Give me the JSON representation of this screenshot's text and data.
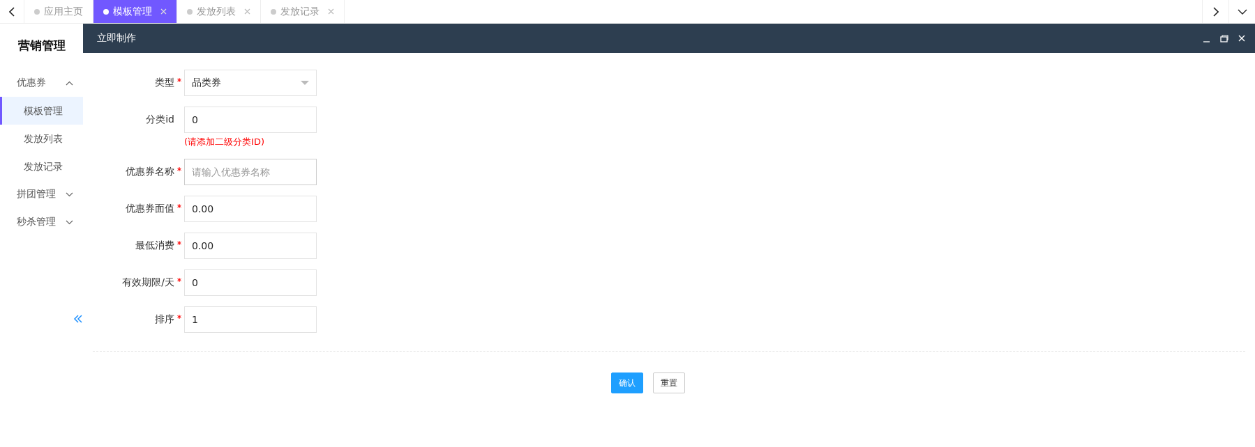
{
  "tabs": [
    {
      "label": "应用主页",
      "selected": false,
      "closable": false
    },
    {
      "label": "模板管理",
      "selected": true,
      "closable": true
    },
    {
      "label": "发放列表",
      "selected": false,
      "closable": true
    },
    {
      "label": "发放记录",
      "selected": false,
      "closable": true
    }
  ],
  "sidebar": {
    "title": "营销管理",
    "menus": [
      {
        "label": "优惠券",
        "expanded": true,
        "children": [
          {
            "label": "模板管理",
            "selected": true
          },
          {
            "label": "发放列表",
            "selected": false
          },
          {
            "label": "发放记录",
            "selected": false
          }
        ]
      },
      {
        "label": "拼团管理",
        "expanded": false
      },
      {
        "label": "秒杀管理",
        "expanded": false
      }
    ]
  },
  "dialog": {
    "title": "立即制作"
  },
  "form": {
    "fields": [
      {
        "kind": "select",
        "label": "类型",
        "required": true,
        "value": "品类券"
      },
      {
        "kind": "input",
        "label": "分类id",
        "required": false,
        "value": "0",
        "hint": "(请添加二级分类ID)"
      },
      {
        "kind": "input",
        "label": "优惠券名称",
        "required": true,
        "placeholder": "请输入优惠券名称"
      },
      {
        "kind": "input",
        "label": "优惠券面值",
        "required": true,
        "value": "0.00"
      },
      {
        "kind": "input",
        "label": "最低消费",
        "required": true,
        "value": "0.00"
      },
      {
        "kind": "input",
        "label": "有效期限/天",
        "required": true,
        "value": "0"
      },
      {
        "kind": "input",
        "label": "排序",
        "required": true,
        "value": "1"
      }
    ]
  },
  "buttons": [
    {
      "label": "确认",
      "kind": "primary"
    },
    {
      "label": "重置",
      "kind": "default"
    }
  ]
}
